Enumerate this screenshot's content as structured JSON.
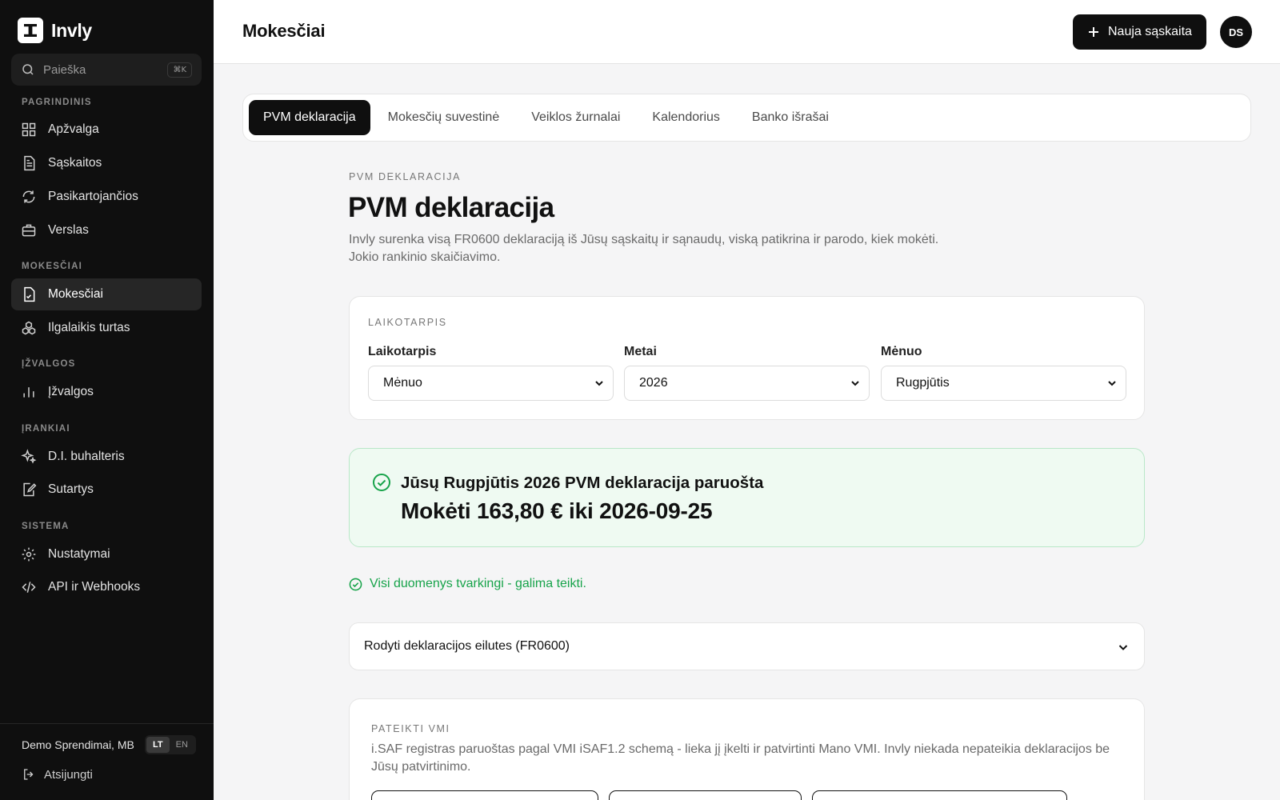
{
  "sidebar": {
    "brand": "Invly",
    "search": {
      "label": "Paieška",
      "shortcut": "⌘K"
    },
    "sections": [
      {
        "title": "PAGRINDINIS",
        "items": [
          {
            "label": "Apžvalga",
            "icon": "grid-icon"
          },
          {
            "label": "Sąskaitos",
            "icon": "document-icon"
          },
          {
            "label": "Pasikartojančios",
            "icon": "refresh-icon"
          },
          {
            "label": "Verslas",
            "icon": "briefcase-icon"
          }
        ]
      },
      {
        "title": "MOKESČIAI",
        "items": [
          {
            "label": "Mokesčiai",
            "icon": "tax-document-icon",
            "active": true
          },
          {
            "label": "Ilgalaikis turtas",
            "icon": "assets-icon"
          }
        ]
      },
      {
        "title": "ĮŽVALGOS",
        "items": [
          {
            "label": "Įžvalgos",
            "icon": "bar-chart-icon"
          }
        ]
      },
      {
        "title": "ĮRANKIAI",
        "items": [
          {
            "label": "D.I. buhalteris",
            "icon": "sparkles-icon"
          },
          {
            "label": "Sutartys",
            "icon": "contract-icon"
          }
        ]
      },
      {
        "title": "SISTEMA",
        "items": [
          {
            "label": "Nustatymai",
            "icon": "gear-icon"
          },
          {
            "label": "API ir Webhooks",
            "icon": "code-icon"
          }
        ]
      }
    ],
    "footer": {
      "company": "Demo Sprendimai, MB",
      "lang_active": "LT",
      "lang_other": "EN",
      "logout": "Atsijungti"
    }
  },
  "header": {
    "title": "Mokesčiai",
    "new_button": "Nauja sąskaita",
    "avatar_initials": "DS"
  },
  "tabs": [
    {
      "label": "PVM deklaracija",
      "active": true
    },
    {
      "label": "Mokesčių suvestinė"
    },
    {
      "label": "Veiklos žurnalai"
    },
    {
      "label": "Kalendorius"
    },
    {
      "label": "Banko išrašai"
    }
  ],
  "main": {
    "eyebrow": "PVM DEKLARACIJA",
    "title": "PVM deklaracija",
    "lead": "Invly surenka visą FR0600 deklaraciją iš Jūsų sąskaitų ir sąnaudų, viską patikrina ir parodo, kiek mokėti. Jokio rankinio skaičiavimo.",
    "period_card": {
      "label": "LAIKOTARPIS",
      "fields": [
        {
          "label": "Laikotarpis",
          "value": "Mėnuo"
        },
        {
          "label": "Metai",
          "value": "2026"
        },
        {
          "label": "Mėnuo",
          "value": "Rugpjūtis"
        }
      ]
    },
    "status": {
      "title": "Jūsų Rugpjūtis 2026 PVM deklaracija paruošta",
      "amount": "Mokėti 163,80 € iki 2026-09-25",
      "accent": "#17a34a"
    },
    "validation": "Visi duomenys tvarkingi - galima teikti.",
    "accordion_label": "Rodyti deklaracijos eilutes (FR0600)",
    "vmi_card": {
      "label": "PATEIKTI VMI",
      "text": "i.SAF registras paruoštas pagal VMI iSAF1.2 schemą - lieka jį įkelti ir patvirtinti Mano VMI. Invly niekada nepateikia deklaracijos be Jūsų patvirtinimo."
    }
  }
}
